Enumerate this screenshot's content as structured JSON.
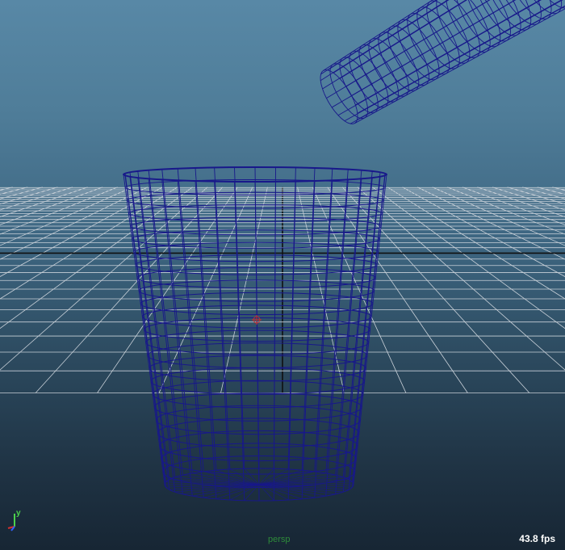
{
  "viewport": {
    "camera_name": "persp",
    "fps_readout": "43.8 fps",
    "axis_label_y": "y"
  },
  "scene": {
    "objects": [
      "cup-wireframe",
      "pouring-tube-wireframe",
      "ground-grid",
      "pivot-marker"
    ]
  },
  "colors": {
    "background_top": "#5888a6",
    "background_bottom": "#172634",
    "wireframe": "#18188a",
    "grid_line": "#c8d0d8",
    "grid_axis": "#101010",
    "axis_y": "#4cd24c",
    "axis_x": "#d23030",
    "axis_z": "#3060ff",
    "camera_label": "#2e8b3a"
  }
}
